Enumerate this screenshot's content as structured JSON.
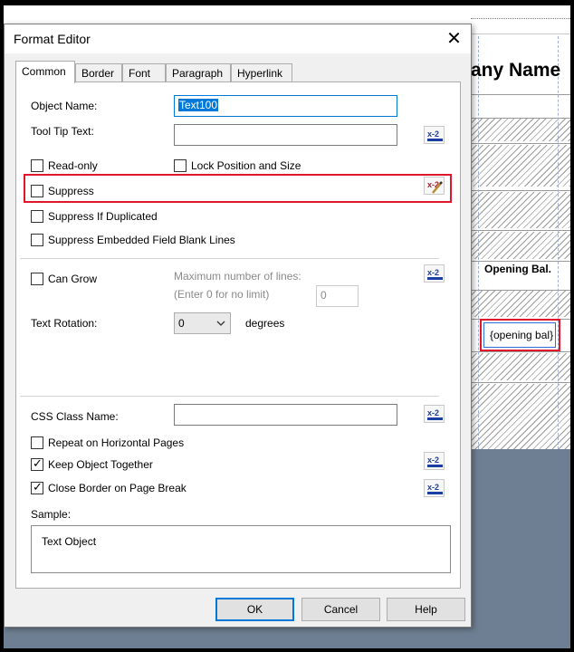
{
  "dialog": {
    "title": "Format Editor",
    "close_glyph": "✕",
    "tabs": [
      {
        "label": "Common",
        "active": true
      },
      {
        "label": "Border",
        "active": false
      },
      {
        "label": "Font",
        "active": false
      },
      {
        "label": "Paragraph",
        "active": false
      },
      {
        "label": "Hyperlink",
        "active": false
      }
    ],
    "fields": {
      "object_name_label": "Object Name:",
      "object_name_value": "Text100",
      "tooltip_label": "Tool Tip Text:",
      "tooltip_value": "",
      "max_lines_label": "Maximum number of lines:",
      "max_lines_hint": "(Enter 0 for no limit)",
      "max_lines_value": "0",
      "text_rotation_label": "Text Rotation:",
      "text_rotation_value": "0",
      "degrees_label": "degrees",
      "css_class_label": "CSS Class Name:",
      "css_class_value": "",
      "sample_label": "Sample:",
      "sample_text": "Text Object"
    },
    "checkboxes": {
      "read_only": {
        "label": "Read-only",
        "checked": false
      },
      "lock_position": {
        "label": "Lock Position and Size",
        "checked": false
      },
      "suppress": {
        "label": "Suppress",
        "checked": false
      },
      "suppress_if_duplicated": {
        "label": "Suppress If Duplicated",
        "checked": false
      },
      "suppress_blank_lines": {
        "label": "Suppress Embedded Field Blank Lines",
        "checked": false
      },
      "can_grow": {
        "label": "Can Grow",
        "checked": false
      },
      "repeat_horizontal": {
        "label": "Repeat on Horizontal Pages",
        "checked": false
      },
      "keep_together": {
        "label": "Keep Object Together",
        "checked": true
      },
      "close_border": {
        "label": "Close Border on Page Break",
        "checked": true
      }
    },
    "buttons": {
      "ok": "OK",
      "cancel": "Cancel",
      "help": "Help"
    },
    "formula_icon": "x-2"
  },
  "background": {
    "company_heading": "any Name",
    "opening_label": "Opening Bal.",
    "opening_field": "{opening bal}"
  },
  "colors": {
    "highlight_red": "#e0162b",
    "accent_blue": "#0078d7",
    "formula_icon_blue": "#1a3fa3"
  }
}
